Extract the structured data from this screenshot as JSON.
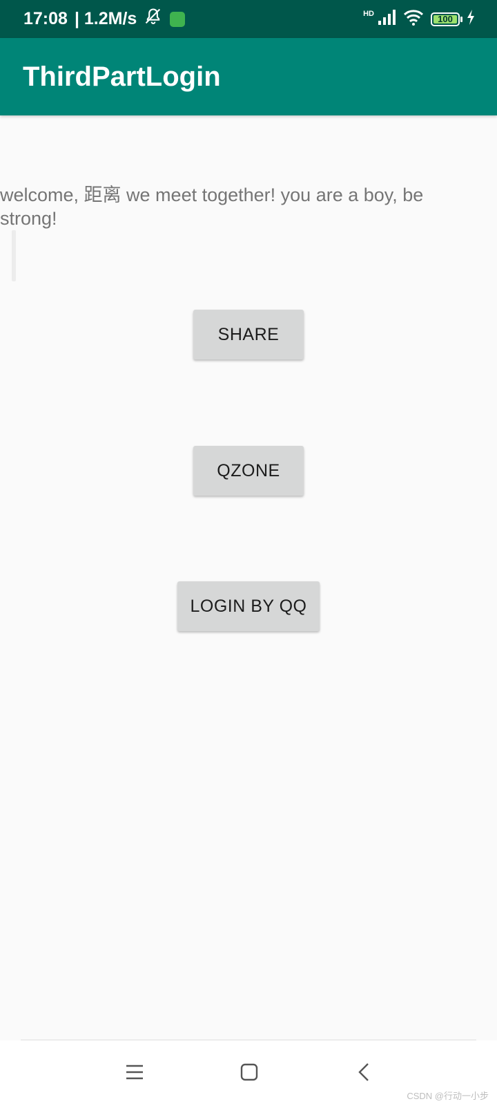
{
  "status_bar": {
    "time": "17:08",
    "network_speed": "| 1.2M/s",
    "hd_label": "HD",
    "battery_level": "100",
    "icons": [
      "mute-bell-icon",
      "app-notification-icon",
      "signal-icon",
      "wifi-icon",
      "battery-icon",
      "charging-icon"
    ]
  },
  "app_bar": {
    "title": "ThirdPartLogin",
    "color": "#008577",
    "status_color": "#00574b"
  },
  "content": {
    "welcome_text": "welcome, 距离 we meet together! you are a boy, be strong!",
    "buttons": {
      "share": "SHARE",
      "qzone": "QZONE",
      "login_qq": "LOGIN BY QQ"
    }
  },
  "nav_bar": {
    "icons": [
      "menu-icon",
      "home-icon",
      "back-icon"
    ]
  },
  "watermark": "CSDN @行动一小步"
}
